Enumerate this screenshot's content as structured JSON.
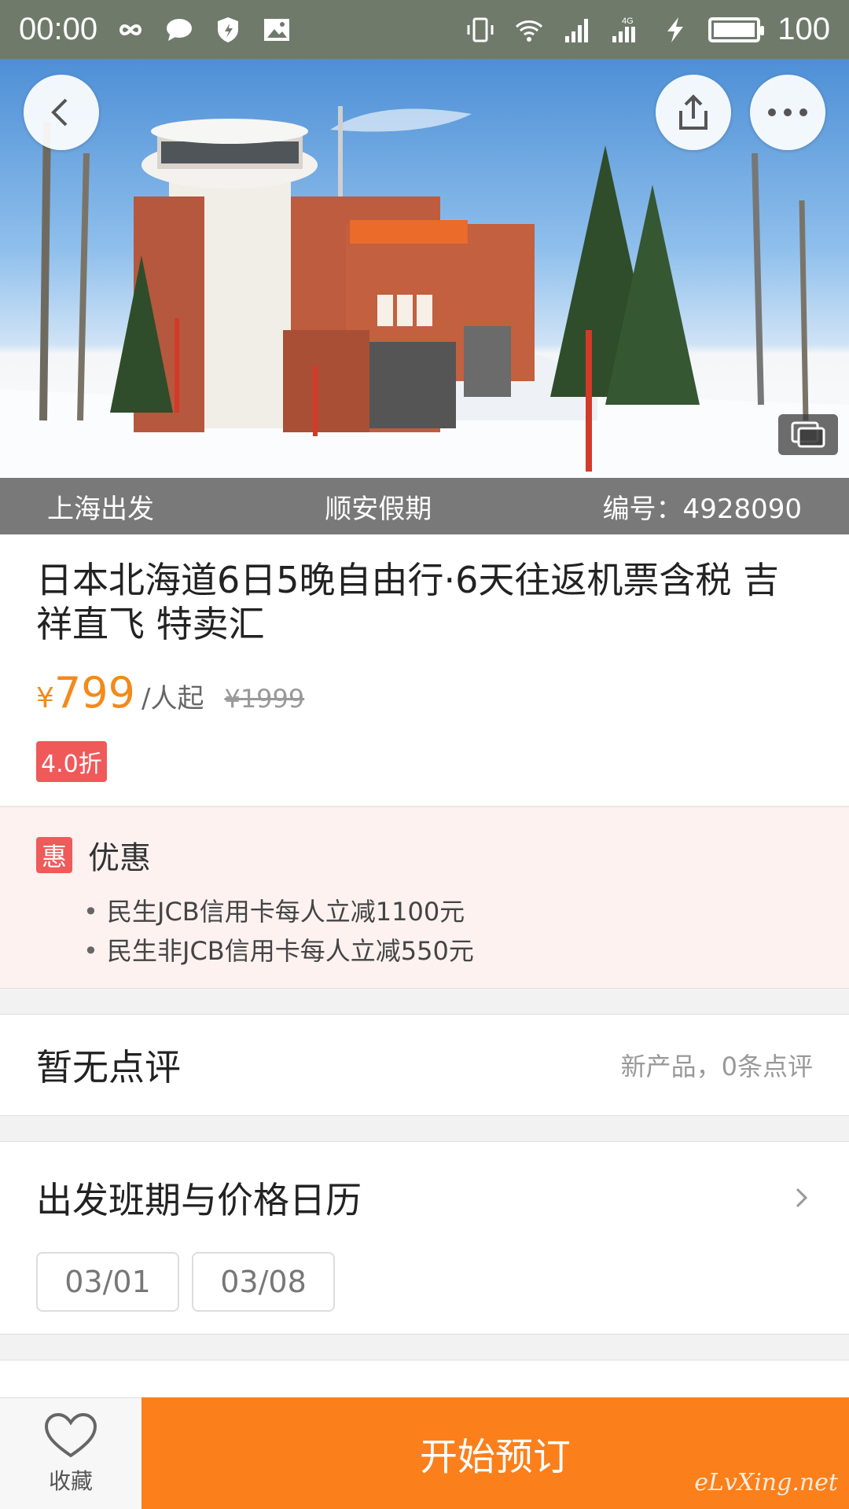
{
  "status_bar": {
    "time": "00:00",
    "battery_level": "100",
    "network_type": "4G",
    "icons_left": [
      "infinity-icon",
      "chat-bubble-icon",
      "shield-icon",
      "image-icon"
    ],
    "icons_right": [
      "vibrate-icon",
      "wifi-icon",
      "signal-icon",
      "signal-4g-icon",
      "charging-icon",
      "battery-icon"
    ]
  },
  "hero": {
    "departure": "上海出发",
    "agency": "顺安假期",
    "product_id": "编号：4928090",
    "buttons": [
      "back-icon",
      "share-icon",
      "more-icon",
      "gallery-icon"
    ]
  },
  "product": {
    "title": "日本北海道6日5晚自由行·6天往返机票含税 吉祥直飞 特卖汇",
    "currency": "¥",
    "price": "799",
    "price_unit": "/人起",
    "original_price": "¥1999",
    "discount": "4.0折"
  },
  "promo": {
    "tag": "惠",
    "title": "优惠",
    "items": [
      "民生JCB信用卡每人立减1100元",
      "民生非JCB信用卡每人立减550元"
    ]
  },
  "reviews": {
    "title": "暂无点评",
    "meta": "新产品，0条点评"
  },
  "calendar": {
    "title": "出发班期与价格日历",
    "dates": [
      "03/01",
      "03/08"
    ]
  },
  "bottom": {
    "favorite_label": "收藏",
    "book_label": "开始预订",
    "watermark": "eLvXing.net"
  },
  "colors": {
    "accent": "#f28a1c",
    "book_button": "#fb7f1a",
    "discount_badge": "#f0595a",
    "promo_bg": "#fdf2f0",
    "status_bar": "#6f7a6b"
  }
}
